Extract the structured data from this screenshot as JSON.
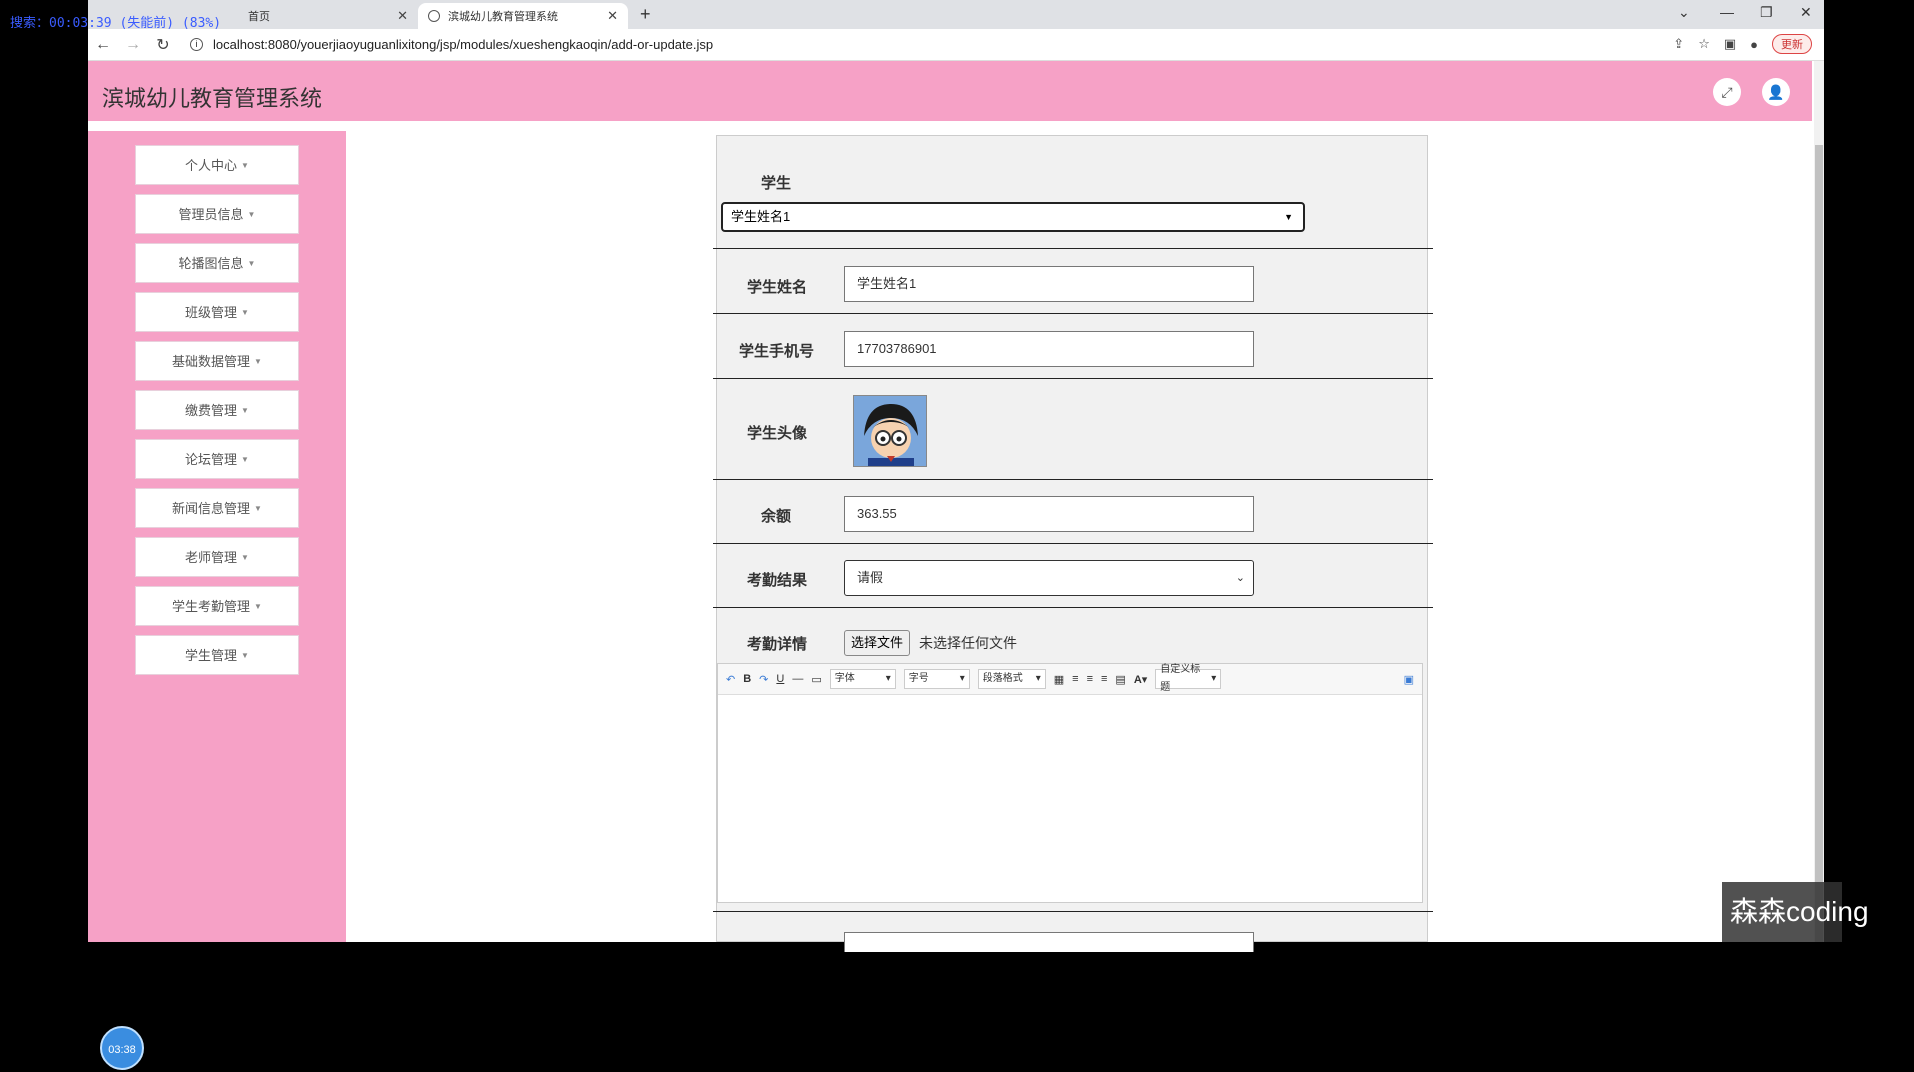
{
  "recorder_overlay": "搜索：00:03:39 (失能前) (83%)",
  "browser": {
    "tabs": [
      {
        "label": "首页"
      },
      {
        "label": "滨城幼儿教育管理系统"
      }
    ],
    "url": "localhost:8080/youerjiaoyuguanlixitong/jsp/modules/xueshengkaoqin/add-or-update.jsp",
    "update_label": "更新"
  },
  "app": {
    "title": "滨城幼儿教育管理系统",
    "header_icons": [
      "fullscreen-icon",
      "user-icon"
    ],
    "accent_color": "#f6a1c6"
  },
  "sidebar": {
    "items": [
      {
        "label": "个人中心"
      },
      {
        "label": "管理员信息"
      },
      {
        "label": "轮播图信息"
      },
      {
        "label": "班级管理"
      },
      {
        "label": "基础数据管理"
      },
      {
        "label": "缴费管理"
      },
      {
        "label": "论坛管理"
      },
      {
        "label": "新闻信息管理"
      },
      {
        "label": "老师管理"
      },
      {
        "label": "学生考勤管理"
      },
      {
        "label": "学生管理"
      }
    ]
  },
  "form": {
    "student_label": "学生",
    "student_select_value": "学生姓名1",
    "name_label": "学生姓名",
    "name_value": "学生姓名1",
    "phone_label": "学生手机号",
    "phone_value": "17703786901",
    "avatar_label": "学生头像",
    "balance_label": "余额",
    "balance_value": "363.55",
    "result_label": "考勤结果",
    "result_value": "请假",
    "detail_label": "考勤详情",
    "file_button": "选择文件",
    "file_status": "未选择任何文件",
    "editor_toolbar": {
      "font": "字体",
      "size": "字号",
      "paragraph": "段落格式",
      "custom_title": "自定义标题"
    }
  },
  "clock_badge": "03:38",
  "watermark": "森森coding"
}
